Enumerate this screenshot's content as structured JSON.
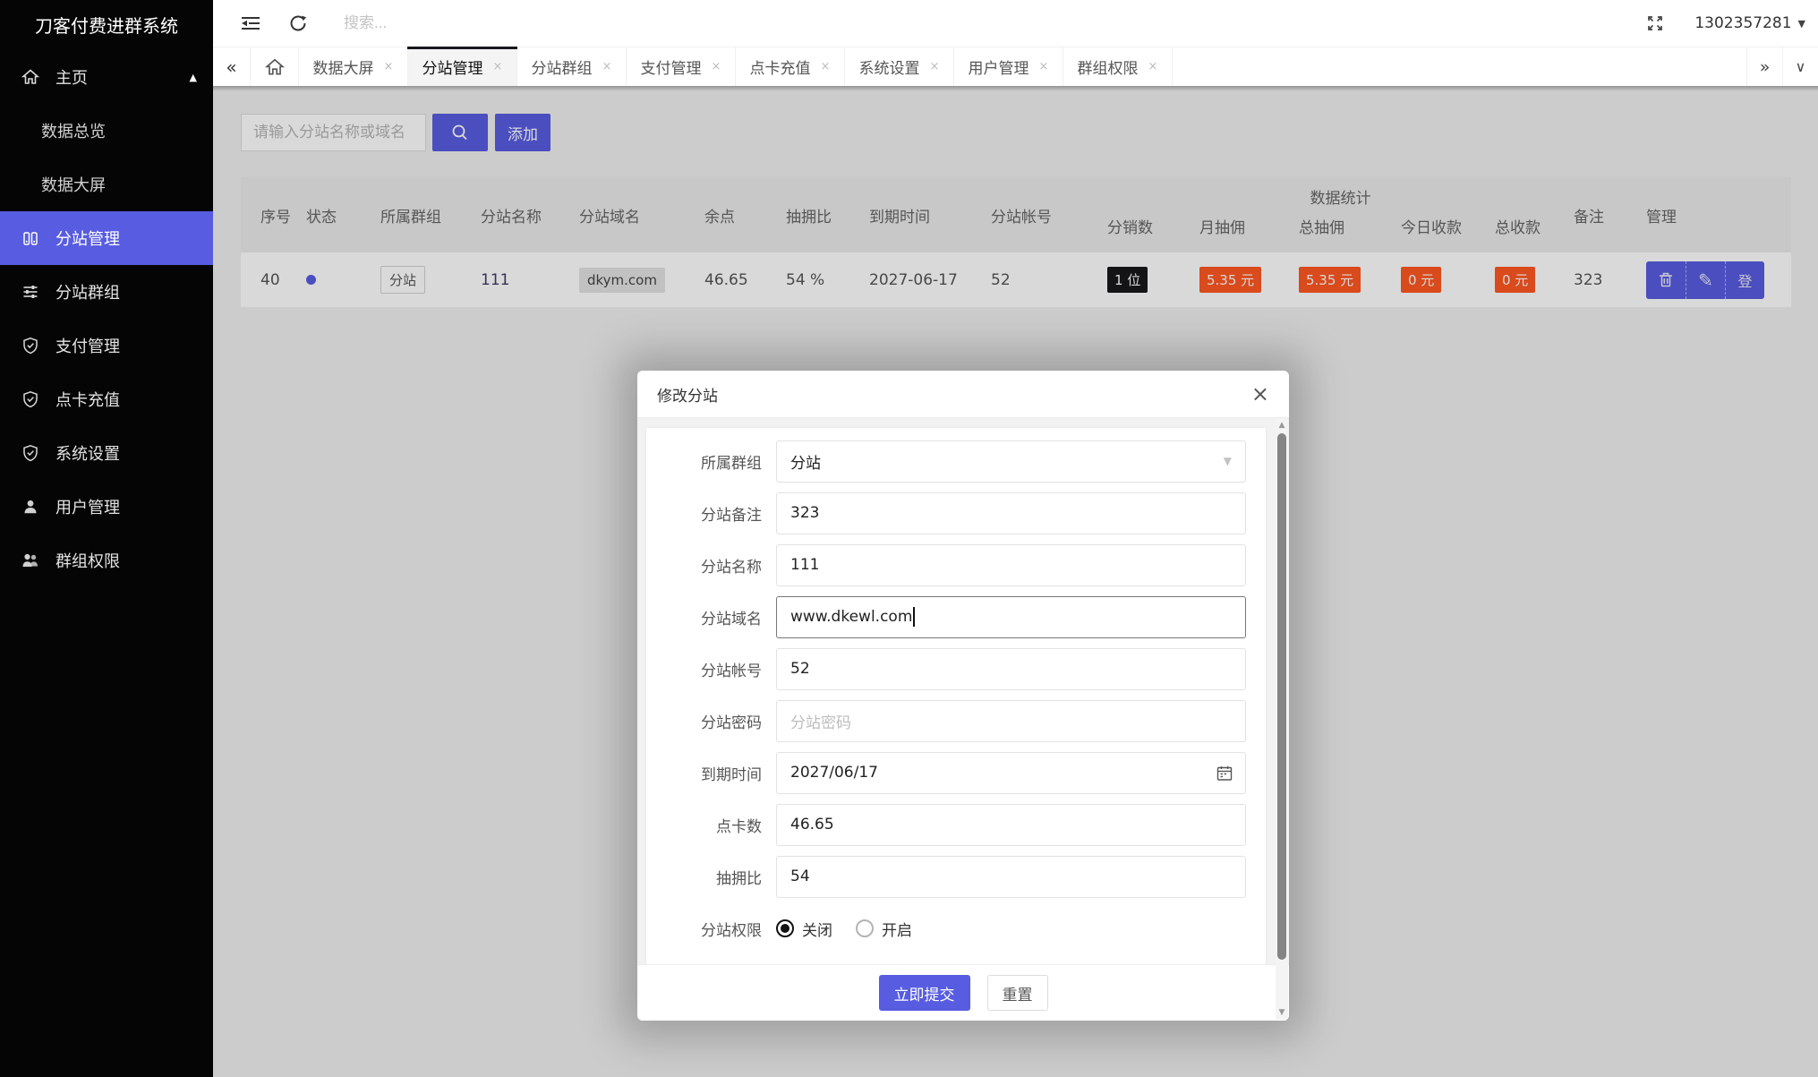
{
  "colors": {
    "accent": "#575CE0",
    "danger": "#FF5722",
    "dark_badge": "#18181C",
    "sidebar_bg": "#050505"
  },
  "app": {
    "title": "刀客付费进群系统"
  },
  "topbar": {
    "search_placeholder": "搜索...",
    "user_id": "1302357281"
  },
  "sidebar": {
    "items": [
      {
        "label": "主页"
      },
      {
        "label": "数据总览"
      },
      {
        "label": "数据大屏"
      },
      {
        "label": "分站管理"
      },
      {
        "label": "分站群组"
      },
      {
        "label": "支付管理"
      },
      {
        "label": "点卡充值"
      },
      {
        "label": "系统设置"
      },
      {
        "label": "用户管理"
      },
      {
        "label": "群组权限"
      }
    ]
  },
  "tabs": {
    "items": [
      {
        "label": "数据大屏"
      },
      {
        "label": "分站管理"
      },
      {
        "label": "分站群组"
      },
      {
        "label": "支付管理"
      },
      {
        "label": "点卡充值"
      },
      {
        "label": "系统设置"
      },
      {
        "label": "用户管理"
      },
      {
        "label": "群组权限"
      }
    ]
  },
  "toolbar": {
    "search_placeholder": "请输入分站名称或域名",
    "add_label": "添加"
  },
  "table": {
    "columns": [
      "序号",
      "状态",
      "所属群组",
      "分站名称",
      "分站域名",
      "余点",
      "抽拥比",
      "到期时间",
      "分站帐号"
    ],
    "group_header": "数据统计",
    "group_columns": [
      "分销数",
      "月抽佣",
      "总抽佣",
      "今日收款",
      "总收款"
    ],
    "tail_columns": [
      "备注",
      "管理"
    ],
    "row": {
      "seq": "40",
      "group": "分站",
      "name": "111",
      "domain": "dkym.com",
      "balance": "46.65",
      "commission_rate": "54 %",
      "expire": "2027-06-17",
      "account": "52",
      "distributors": "1 位",
      "month_commission": "5.35 元",
      "total_commission": "5.35 元",
      "today_income": "0 元",
      "total_income": "0 元",
      "remark": "323",
      "login_label": "登"
    }
  },
  "modal": {
    "title": "修改分站",
    "fields": [
      {
        "label": "所属群组",
        "value": "分站"
      },
      {
        "label": "分站备注",
        "value": "323"
      },
      {
        "label": "分站名称",
        "value": "111"
      },
      {
        "label": "分站域名",
        "value": "www.dkewl.com"
      },
      {
        "label": "分站帐号",
        "value": "52"
      },
      {
        "label": "分站密码",
        "value": "",
        "placeholder": "分站密码"
      },
      {
        "label": "到期时间",
        "value": "2027/06/17"
      },
      {
        "label": "点卡数",
        "value": "46.65"
      },
      {
        "label": "抽拥比",
        "value": "54"
      },
      {
        "label": "分站权限",
        "options": [
          {
            "label": "关闭",
            "checked": true
          },
          {
            "label": "开启",
            "checked": false
          }
        ]
      }
    ],
    "submit_label": "立即提交",
    "reset_label": "重置"
  }
}
